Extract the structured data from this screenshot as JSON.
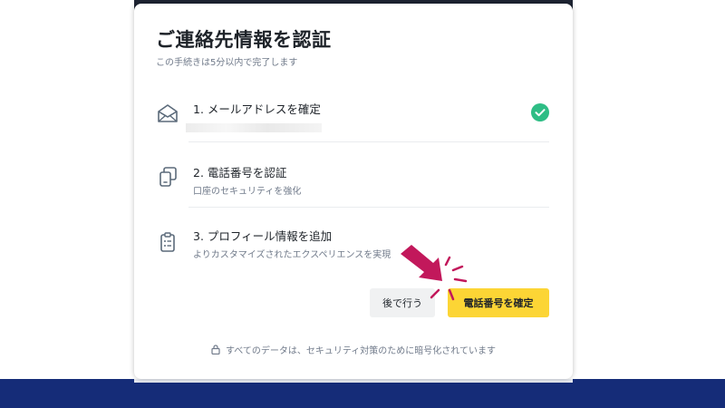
{
  "modal": {
    "title": "ご連絡先情報を認証",
    "subtitle": "この手続きは5分以内で完了します"
  },
  "steps": [
    {
      "label": "1. メールアドレスを確定",
      "desc": "",
      "icon": "envelope-open-icon",
      "status": "completed"
    },
    {
      "label": "2. 電話番号を認証",
      "desc": "口座のセキュリティを強化",
      "icon": "phone-verify-icon",
      "status": "pending"
    },
    {
      "label": "3. プロフィール情報を追加",
      "desc": "よりカスタマイズされたエクスペリエンスを実現",
      "icon": "clipboard-icon",
      "status": "pending"
    }
  ],
  "buttons": {
    "later": "後で行う",
    "confirm": "電話番号を確定"
  },
  "footer_note": "すべてのデータは、セキュリティ対策のために暗号化されています",
  "colors": {
    "accent": "#fcd535",
    "success": "#2ebd85",
    "pointer": "#c2185b",
    "footer_bar": "#152c78"
  }
}
